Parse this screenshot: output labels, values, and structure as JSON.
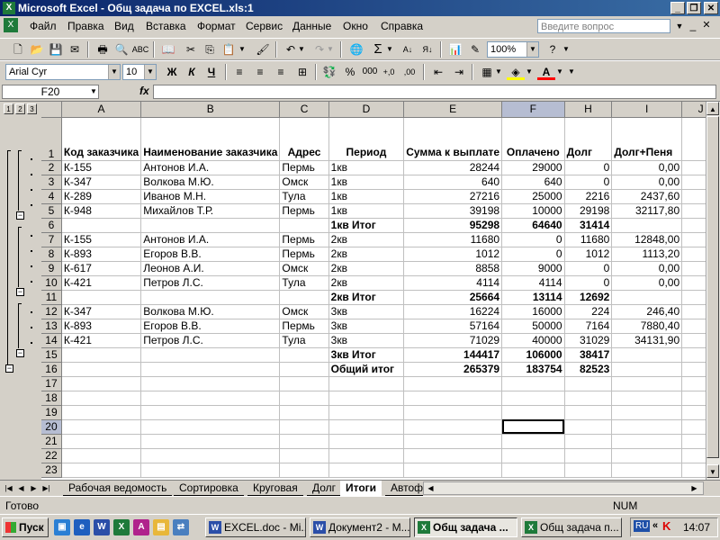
{
  "window": {
    "title": "Microsoft Excel - Общ задача по EXCEL.xls:1"
  },
  "menu": {
    "items": [
      "Файл",
      "Правка",
      "Вид",
      "Вставка",
      "Формат",
      "Сервис",
      "Данные",
      "Окно",
      "Справка"
    ],
    "ask_placeholder": "Введите вопрос"
  },
  "toolbar": {
    "zoom": "100%",
    "font_name": "Arial Cyr",
    "font_size": "10",
    "bold": "Ж",
    "italic": "К",
    "underline": "Ч",
    "sum": "Σ",
    "percent": "%",
    "thousands": "000"
  },
  "formula_bar": {
    "name_box": "F20",
    "fx": "fx",
    "content": ""
  },
  "outline": {
    "levels": [
      "1",
      "2",
      "3"
    ]
  },
  "columns": [
    "A",
    "B",
    "C",
    "D",
    "E",
    "F",
    "H",
    "I",
    "J"
  ],
  "header_row": {
    "row": "1",
    "A": "Код заказчика",
    "B": "Наименование заказчика",
    "C": "Адрес",
    "D": "Период",
    "E": "Сумма к выплате",
    "F": "Оплачено",
    "H": "Долг",
    "I": "Долг+Пеня",
    "J": ""
  },
  "rows": [
    {
      "row": "2",
      "A": "К-155",
      "B": "Антонов И.А.",
      "C": "Пермь",
      "D": "1кв",
      "E": "28244",
      "F": "29000",
      "H": "0",
      "I": "0,00",
      "bold": false
    },
    {
      "row": "3",
      "A": "К-347",
      "B": "Волкова М.Ю.",
      "C": "Омск",
      "D": "1кв",
      "E": "640",
      "F": "640",
      "H": "0",
      "I": "0,00",
      "bold": false
    },
    {
      "row": "4",
      "A": "К-289",
      "B": "Иванов М.Н.",
      "C": "Тула",
      "D": "1кв",
      "E": "27216",
      "F": "25000",
      "H": "2216",
      "I": "2437,60",
      "bold": false
    },
    {
      "row": "5",
      "A": "К-948",
      "B": "Михайлов Т.Р.",
      "C": "Пермь",
      "D": "1кв",
      "E": "39198",
      "F": "10000",
      "H": "29198",
      "I": "32117,80",
      "bold": false
    },
    {
      "row": "6",
      "A": "",
      "B": "",
      "C": "",
      "D": "1кв Итог",
      "E": "95298",
      "F": "64640",
      "H": "31414",
      "I": "",
      "bold": true
    },
    {
      "row": "7",
      "A": "К-155",
      "B": "Антонов И.А.",
      "C": "Пермь",
      "D": "2кв",
      "E": "11680",
      "F": "0",
      "H": "11680",
      "I": "12848,00",
      "bold": false
    },
    {
      "row": "8",
      "A": "К-893",
      "B": "Егоров В.В.",
      "C": "Пермь",
      "D": "2кв",
      "E": "1012",
      "F": "0",
      "H": "1012",
      "I": "1113,20",
      "bold": false
    },
    {
      "row": "9",
      "A": "К-617",
      "B": "Леонов А.И.",
      "C": "Омск",
      "D": "2кв",
      "E": "8858",
      "F": "9000",
      "H": "0",
      "I": "0,00",
      "bold": false
    },
    {
      "row": "10",
      "A": "К-421",
      "B": "Петров Л.С.",
      "C": "Тула",
      "D": "2кв",
      "E": "4114",
      "F": "4114",
      "H": "0",
      "I": "0,00",
      "bold": false
    },
    {
      "row": "11",
      "A": "",
      "B": "",
      "C": "",
      "D": "2кв Итог",
      "E": "25664",
      "F": "13114",
      "H": "12692",
      "I": "",
      "bold": true
    },
    {
      "row": "12",
      "A": "К-347",
      "B": "Волкова М.Ю.",
      "C": "Омск",
      "D": "3кв",
      "E": "16224",
      "F": "16000",
      "H": "224",
      "I": "246,40",
      "bold": false
    },
    {
      "row": "13",
      "A": "К-893",
      "B": "Егоров В.В.",
      "C": "Пермь",
      "D": "3кв",
      "E": "57164",
      "F": "50000",
      "H": "7164",
      "I": "7880,40",
      "bold": false
    },
    {
      "row": "14",
      "A": "К-421",
      "B": "Петров Л.С.",
      "C": "Тула",
      "D": "3кв",
      "E": "71029",
      "F": "40000",
      "H": "31029",
      "I": "34131,90",
      "bold": false
    },
    {
      "row": "15",
      "A": "",
      "B": "",
      "C": "",
      "D": "3кв Итог",
      "E": "144417",
      "F": "106000",
      "H": "38417",
      "I": "",
      "bold": true
    },
    {
      "row": "16",
      "A": "",
      "B": "",
      "C": "",
      "D": "Общий итог",
      "E": "265379",
      "F": "183754",
      "H": "82523",
      "I": "",
      "bold": true
    },
    {
      "row": "17",
      "A": "",
      "B": "",
      "C": "",
      "D": "",
      "E": "",
      "F": "",
      "H": "",
      "I": "",
      "bold": false
    },
    {
      "row": "18",
      "A": "",
      "B": "",
      "C": "",
      "D": "",
      "E": "",
      "F": "",
      "H": "",
      "I": "",
      "bold": false
    },
    {
      "row": "19",
      "A": "",
      "B": "",
      "C": "",
      "D": "",
      "E": "",
      "F": "",
      "H": "",
      "I": "",
      "bold": false
    },
    {
      "row": "20",
      "A": "",
      "B": "",
      "C": "",
      "D": "",
      "E": "",
      "F": "",
      "H": "",
      "I": "",
      "bold": false
    },
    {
      "row": "21",
      "A": "",
      "B": "",
      "C": "",
      "D": "",
      "E": "",
      "F": "",
      "H": "",
      "I": "",
      "bold": false
    },
    {
      "row": "22",
      "A": "",
      "B": "",
      "C": "",
      "D": "",
      "E": "",
      "F": "",
      "H": "",
      "I": "",
      "bold": false
    },
    {
      "row": "23",
      "A": "",
      "B": "",
      "C": "",
      "D": "",
      "E": "",
      "F": "",
      "H": "",
      "I": "",
      "bold": false
    }
  ],
  "selected_cell": "F20",
  "sheet_tabs": [
    "Рабочая ведомость",
    "Сортировка",
    "Круговая",
    "Долг",
    "Итоги",
    "Автоф"
  ],
  "active_tab": "Итоги",
  "status": {
    "left": "Готово",
    "num": "NUM"
  },
  "taskbar": {
    "start": "Пуск",
    "buttons": [
      "EXCEL.doc - Mi...",
      "Документ2 - М...",
      "Общ задача ...",
      "Общ задача п..."
    ],
    "active_button": "Общ задача ...",
    "lang": "RU",
    "clock": "14:07"
  }
}
